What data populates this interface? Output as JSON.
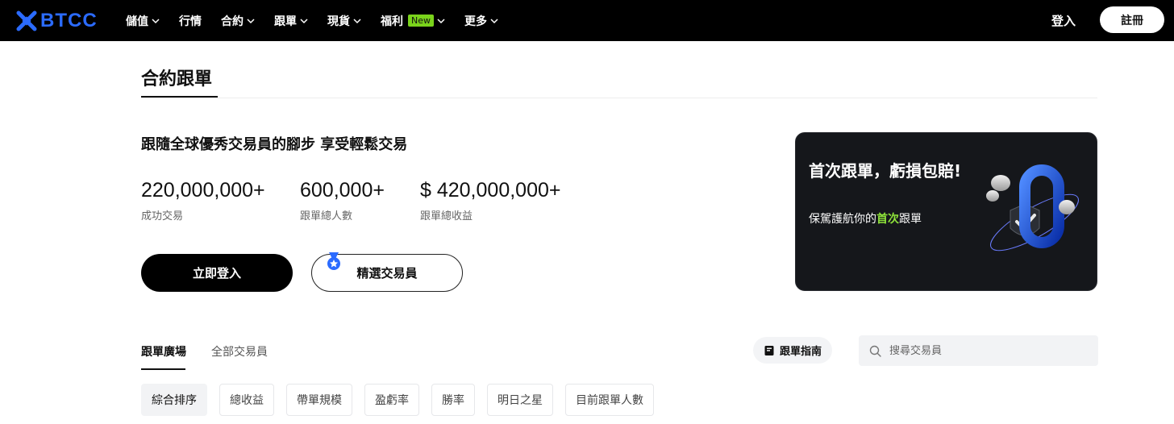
{
  "header": {
    "logo_text": "BTCC",
    "nav": [
      {
        "label": "儲值",
        "has_dropdown": true
      },
      {
        "label": "行情",
        "has_dropdown": false
      },
      {
        "label": "合約",
        "has_dropdown": true
      },
      {
        "label": "跟單",
        "has_dropdown": true
      },
      {
        "label": "現貨",
        "has_dropdown": true
      },
      {
        "label": "福利",
        "badge": "New",
        "has_dropdown": true
      },
      {
        "label": "更多",
        "has_dropdown": true
      }
    ],
    "login": "登入",
    "register": "註冊"
  },
  "page": {
    "title": "合約跟單",
    "headline": "跟隨全球優秀交易員的腳步 享受輕鬆交易",
    "stats": [
      {
        "value": "220,000,000+",
        "label": "成功交易"
      },
      {
        "value": "600,000+",
        "label": "跟單總人數"
      },
      {
        "value": "$ 420,000,000+",
        "label": "跟單總收益"
      }
    ],
    "login_button": "立即登入",
    "traders_button": "精選交易員"
  },
  "promo": {
    "title": "首次跟單，虧損包賠!",
    "sub_prefix": "保駕護航你的",
    "sub_highlight": "首次",
    "sub_suffix": "跟單",
    "highlight_color": "#8ee33a"
  },
  "tabs": {
    "active": "跟單廣場",
    "inactive": "全部交易員",
    "guide": "跟單指南",
    "search_placeholder": "搜尋交易員"
  },
  "filters": [
    "綜合排序",
    "總收益",
    "帶單規模",
    "盈虧率",
    "勝率",
    "明日之星",
    "目前跟單人數"
  ],
  "colors": {
    "brand": "#2b6bff",
    "nav_bg": "#000000",
    "new_badge": "#7ad31b"
  }
}
